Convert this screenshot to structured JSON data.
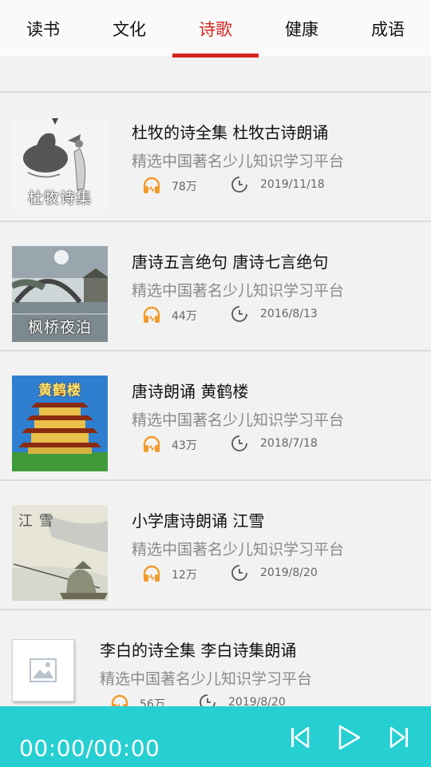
{
  "tabs": [
    {
      "label": "读书",
      "active": false
    },
    {
      "label": "文化",
      "active": false
    },
    {
      "label": "诗歌",
      "active": true
    },
    {
      "label": "健康",
      "active": false
    },
    {
      "label": "成语",
      "active": false
    }
  ],
  "colors": {
    "accent": "#d7251f",
    "player_bg": "#26cfd1",
    "icon_orange": "#f29b2b"
  },
  "items": [
    {
      "thumb_caption": "杜牧诗集",
      "title": "杜牧的诗全集 杜牧古诗朗诵",
      "subtitle": "精选中国著名少儿知识学习平台",
      "plays": "78万",
      "date": "2019/11/18"
    },
    {
      "thumb_caption": "枫桥夜泊",
      "title": "唐诗五言绝句 唐诗七言绝句",
      "subtitle": "精选中国著名少儿知识学习平台",
      "plays": "44万",
      "date": "2016/8/13"
    },
    {
      "thumb_caption": "黄鹤楼",
      "title": "唐诗朗诵 黄鹤楼",
      "subtitle": "精选中国著名少儿知识学习平台",
      "plays": "43万",
      "date": "2018/7/18"
    },
    {
      "thumb_caption": "江 雪",
      "title": "小学唐诗朗诵 江雪",
      "subtitle": "精选中国著名少儿知识学习平台",
      "plays": "12万",
      "date": "2019/8/20"
    },
    {
      "thumb_caption": "",
      "title": "李白的诗全集 李白诗集朗诵",
      "subtitle": "精选中国著名少儿知识学习平台",
      "plays": "56万",
      "date": "2019/8/20"
    }
  ],
  "icons": {
    "plays": "headphones-icon",
    "date": "clock-icon",
    "placeholder": "image-placeholder-icon"
  },
  "player": {
    "time": "00:00/00:00",
    "prev_icon": "skip-previous-icon",
    "play_icon": "play-icon",
    "next_icon": "skip-next-icon"
  }
}
